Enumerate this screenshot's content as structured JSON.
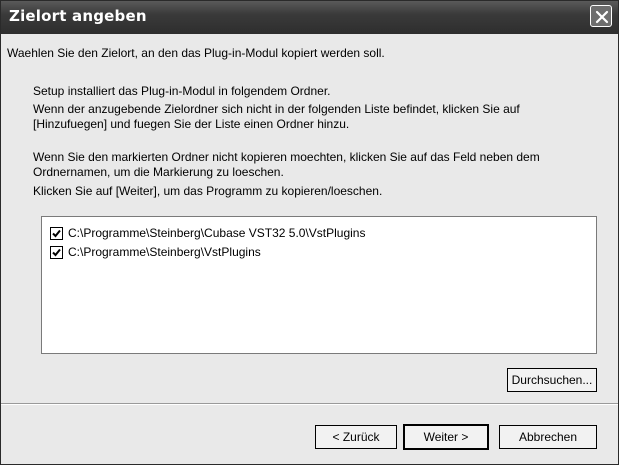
{
  "window": {
    "title": "Zielort angeben"
  },
  "intro": "Waehlen Sie den Zielort, an den das Plug-in-Modul kopiert werden soll.",
  "paragraphs": [
    "Setup installiert das Plug-in-Modul in folgendem Ordner.",
    "Wenn der anzugebende Zielordner sich nicht in der folgenden Liste befindet, klicken Sie auf",
    "[Hinzufuegen] und fuegen Sie der Liste einen Ordner hinzu.",
    "Wenn Sie den markierten Ordner nicht kopieren moechten, klicken Sie auf das Feld neben dem",
    "Ordnernamen, um die Markierung zu loeschen.",
    "Klicken Sie auf [Weiter], um das Programm zu kopieren/loeschen."
  ],
  "folders": [
    {
      "path": "C:\\Programme\\Steinberg\\Cubase VST32 5.0\\VstPlugins",
      "checked": true
    },
    {
      "path": "C:\\Programme\\Steinberg\\VstPlugins",
      "checked": true
    }
  ],
  "buttons": {
    "browse": "Durchsuchen...",
    "back": "< Zurück",
    "next": "Weiter >",
    "cancel": "Abbrechen"
  },
  "icons": {
    "close": "close-icon",
    "check": "checkmark-icon"
  }
}
